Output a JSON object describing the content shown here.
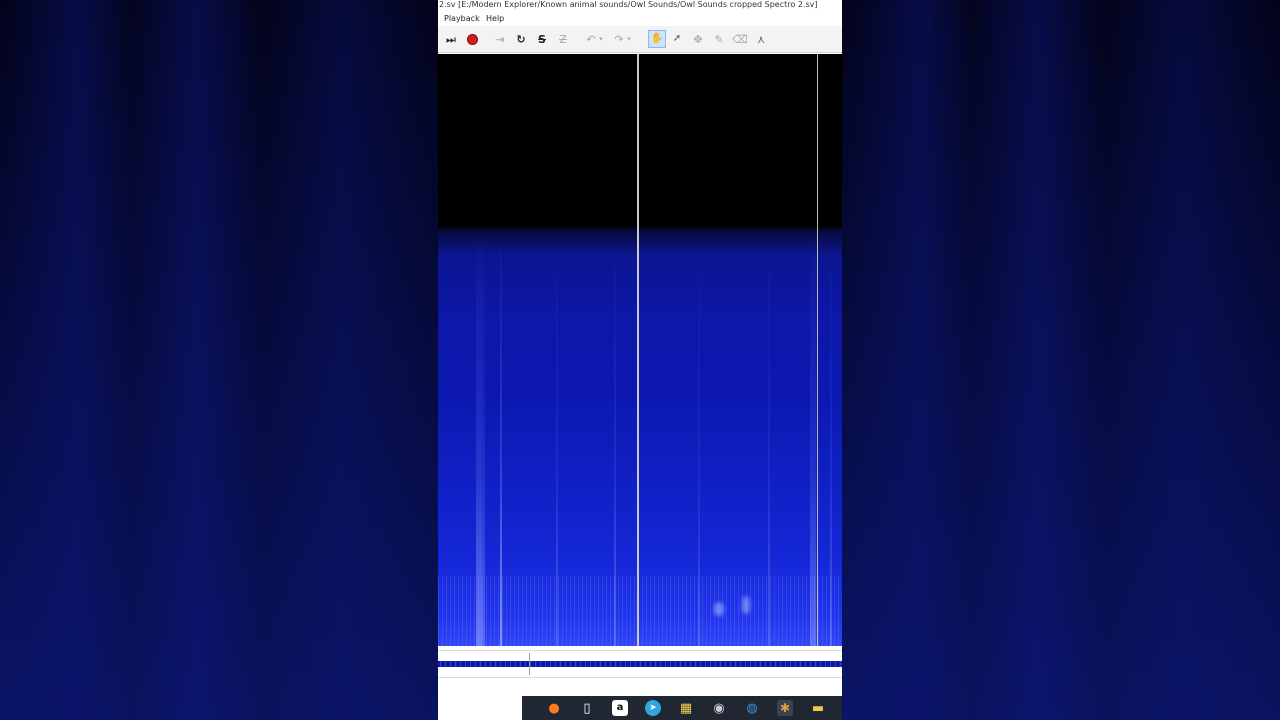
{
  "window": {
    "title": "2.sv [E:/Modern Explorer/Known animal sounds/Owl Sounds/Owl Sounds cropped Spectro 2.sv]"
  },
  "menu": {
    "items": [
      "Playback",
      "Help"
    ]
  },
  "toolbar": {
    "buttons": [
      {
        "name": "play-pause",
        "icon": "play-pause-icon"
      },
      {
        "name": "record",
        "icon": "record-icon"
      },
      {
        "name": "play-selection",
        "icon": "play-selection-icon"
      },
      {
        "name": "loop",
        "icon": "loop-icon"
      },
      {
        "name": "solo",
        "icon": "solo-icon"
      },
      {
        "name": "align",
        "icon": "align-icon"
      },
      {
        "name": "undo",
        "icon": "undo-icon"
      },
      {
        "name": "redo",
        "icon": "redo-icon"
      },
      {
        "name": "navigate-tool",
        "icon": "hand-icon",
        "active": true
      },
      {
        "name": "select-tool",
        "icon": "arrow-cursor-icon"
      },
      {
        "name": "move-tool",
        "icon": "move-icon"
      },
      {
        "name": "draw-tool",
        "icon": "pencil-icon"
      },
      {
        "name": "erase-tool",
        "icon": "eraser-icon"
      },
      {
        "name": "measure-tool",
        "icon": "compass-icon"
      }
    ]
  },
  "glyphs": {
    "play_pause": "⏭",
    "play_selection": "⇥",
    "loop": "↻",
    "solo": "S",
    "align": "Z",
    "undo": "↶",
    "redo": "↷",
    "caret": "▾",
    "hand": "✋",
    "arrow": "➚",
    "move": "✥",
    "pencil": "✎",
    "eraser": "⌫",
    "compass": "⋏"
  },
  "colors": {
    "spectrogram_blue": "#0d17a8",
    "spectrogram_bright": "#3045f5",
    "record_red": "#d21b1b",
    "taskbar": "#202733"
  },
  "taskbar": {
    "apps": [
      {
        "name": "firefox",
        "glyph": "●",
        "color": "#ff7a1a"
      },
      {
        "name": "file",
        "glyph": "▯",
        "color": "#ffffff"
      },
      {
        "name": "amazon",
        "glyph": "a",
        "color": "#ffffff"
      },
      {
        "name": "telegram",
        "glyph": "➤",
        "color": "#2ea6e0"
      },
      {
        "name": "calendar",
        "glyph": "▦",
        "color": "#f4d24a"
      },
      {
        "name": "obs",
        "glyph": "◉",
        "color": "#cccccc"
      },
      {
        "name": "browser",
        "glyph": "◍",
        "color": "#3b8fe0"
      },
      {
        "name": "sonic-visualiser",
        "glyph": "✱",
        "color": "#e0a040"
      },
      {
        "name": "file-explorer",
        "glyph": "▬",
        "color": "#f2c744"
      }
    ]
  }
}
